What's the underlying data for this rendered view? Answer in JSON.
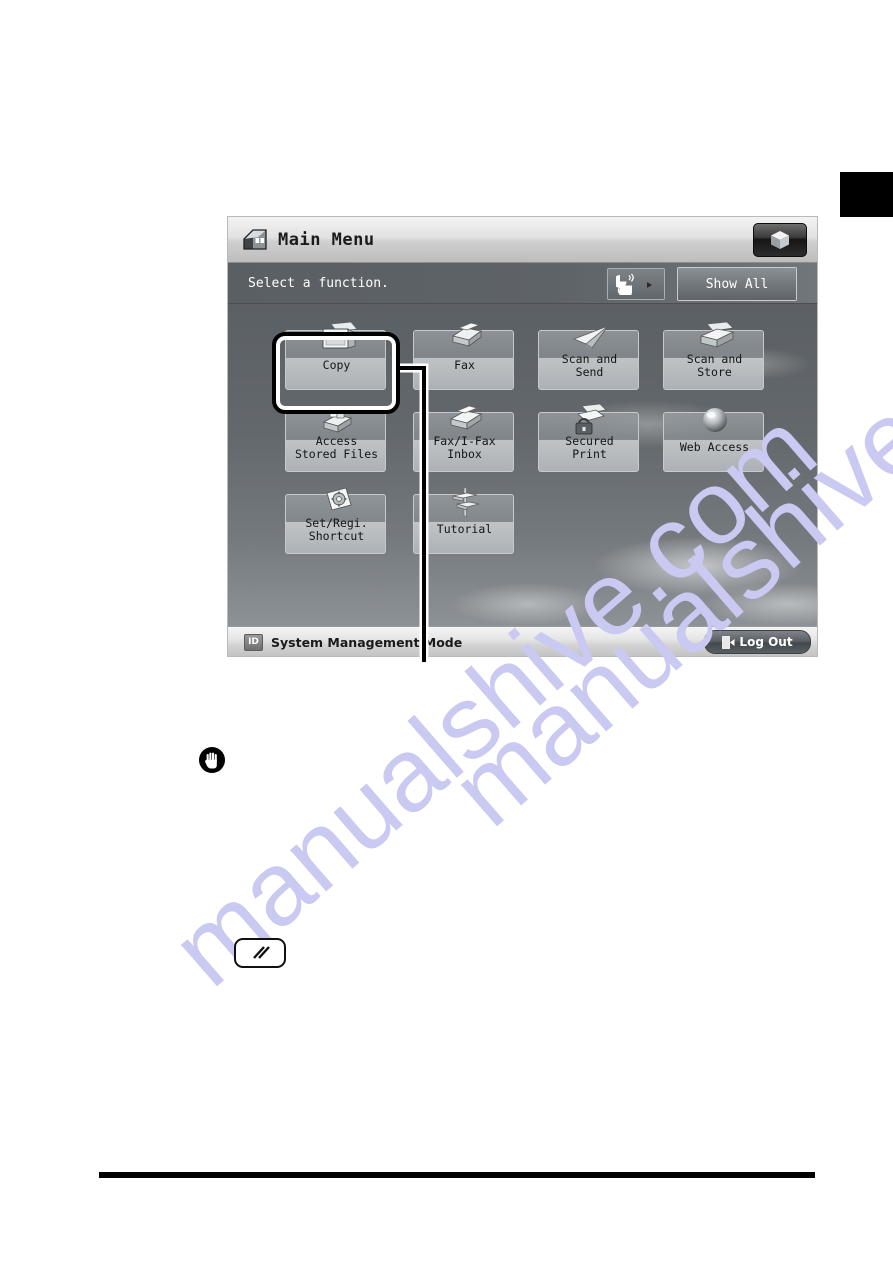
{
  "page": {
    "watermark_text": "manualshive.com",
    "tab_marker": "black-chapter-tab"
  },
  "device_screen": {
    "header": {
      "icon": "home-icon",
      "title": "Main Menu",
      "right_button_icon": "cube-icon"
    },
    "subheader": {
      "prompt": "Select a function.",
      "voice_guidance_icon": "voice-guidance-icon",
      "show_all_label": "Show All"
    },
    "functions": [
      {
        "label": "Copy",
        "icon": "copy-icon",
        "selected": true
      },
      {
        "label": "Fax",
        "icon": "fax-icon",
        "selected": false
      },
      {
        "label": "Scan and\nSend",
        "icon": "scan-send-icon",
        "selected": false
      },
      {
        "label": "Scan and\nStore",
        "icon": "scan-store-icon",
        "selected": false
      },
      {
        "label": "Access\nStored Files",
        "icon": "access-stored-files-icon",
        "selected": false
      },
      {
        "label": "Fax/I-Fax\nInbox",
        "icon": "fax-inbox-icon",
        "selected": false
      },
      {
        "label": "Secured\nPrint",
        "icon": "secured-print-icon",
        "selected": false
      },
      {
        "label": "Web Access",
        "icon": "web-access-icon",
        "selected": false
      },
      {
        "label": "Set/Regi.\nShortcut",
        "icon": "settings-shortcut-icon",
        "selected": false
      },
      {
        "label": "Tutorial",
        "icon": "tutorial-icon",
        "selected": false
      }
    ],
    "footer": {
      "id_badge": "ID",
      "status_text": "System Management Mode",
      "logout_label": "Log Out",
      "logout_icon": "logout-icon"
    }
  },
  "annotations": {
    "important_icon": "hand-important-icon",
    "reset_key_icon": "reset-key-icon"
  },
  "colors": {
    "screen_bg": "#63686c",
    "header_bg": "#e2e2e2",
    "subheader_bg": "#5e6367",
    "button_face": "#b0b5b9",
    "highlight_outline": "#000000",
    "watermark": "#c9c9f2"
  }
}
